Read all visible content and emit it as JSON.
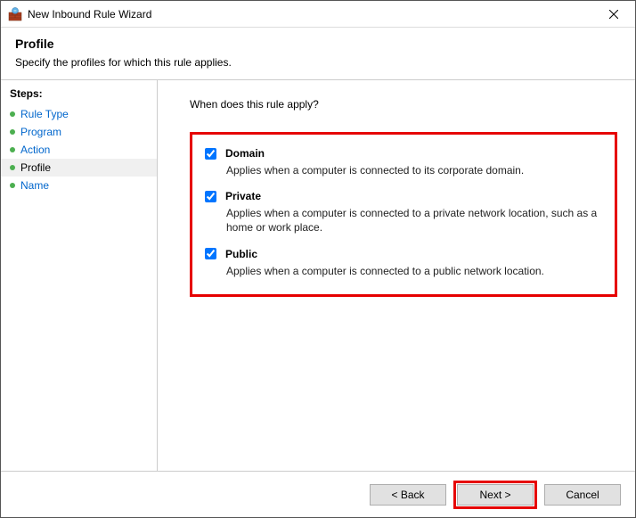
{
  "window": {
    "title": "New Inbound Rule Wizard"
  },
  "header": {
    "title": "Profile",
    "subtitle": "Specify the profiles for which this rule applies."
  },
  "sidebar": {
    "title": "Steps:",
    "items": [
      {
        "label": "Rule Type"
      },
      {
        "label": "Program"
      },
      {
        "label": "Action"
      },
      {
        "label": "Profile"
      },
      {
        "label": "Name"
      }
    ]
  },
  "main": {
    "question": "When does this rule apply?",
    "profiles": [
      {
        "name": "Domain",
        "desc": "Applies when a computer is connected to its corporate domain."
      },
      {
        "name": "Private",
        "desc": "Applies when a computer is connected to a private network location, such as a home or work place."
      },
      {
        "name": "Public",
        "desc": "Applies when a computer is connected to a public network location."
      }
    ]
  },
  "footer": {
    "back": "< Back",
    "next": "Next >",
    "cancel": "Cancel"
  }
}
